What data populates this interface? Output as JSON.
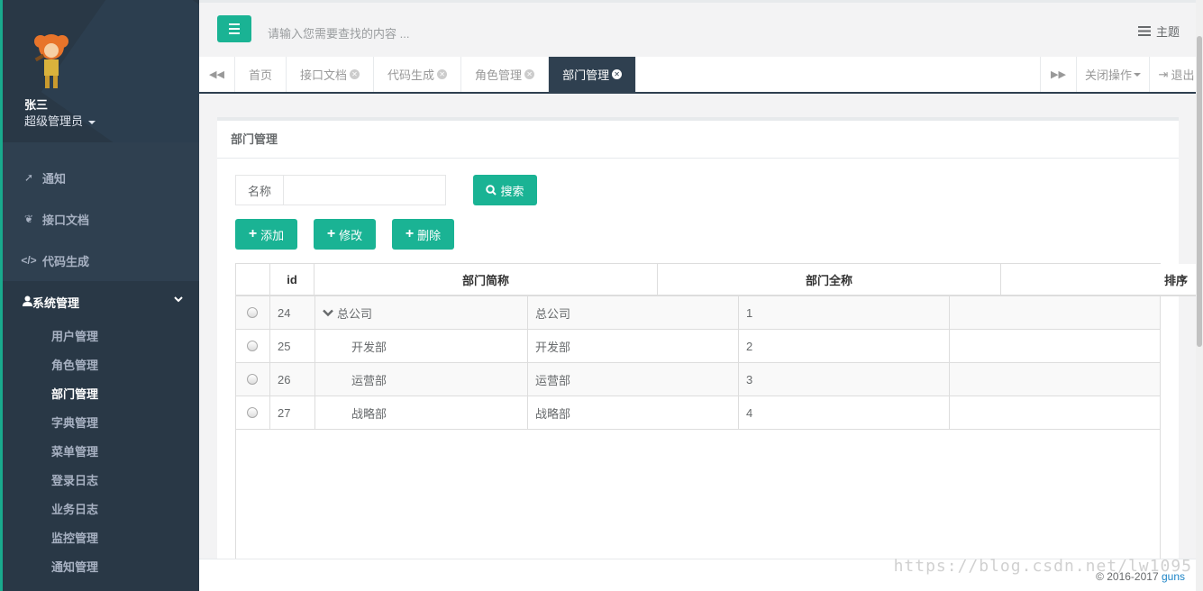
{
  "user": {
    "name": "张三",
    "role": "超级管理员"
  },
  "sidebar": {
    "items": [
      {
        "label": "通知",
        "icon": "rocket-icon"
      },
      {
        "label": "接口文档",
        "icon": "leaf-icon"
      },
      {
        "label": "代码生成",
        "icon": "code-icon"
      }
    ],
    "active_group": {
      "label": "系统管理",
      "icon": "user-icon",
      "children": [
        "用户管理",
        "角色管理",
        "部门管理",
        "字典管理",
        "菜单管理",
        "登录日志",
        "业务日志",
        "监控管理",
        "通知管理"
      ],
      "active_child": "部门管理"
    }
  },
  "topbar": {
    "search_placeholder": "请输入您需要查找的内容 ...",
    "theme_label": "主题"
  },
  "tabs": {
    "items": [
      "首页",
      "接口文档",
      "代码生成",
      "角色管理",
      "部门管理"
    ],
    "active": "部门管理",
    "close_ops": "关闭操作",
    "logout": "退出"
  },
  "panel": {
    "title": "部门管理",
    "search_label": "名称",
    "search_value": "",
    "search_button": "搜索",
    "add_button": "添加",
    "edit_button": "修改",
    "delete_button": "删除"
  },
  "table": {
    "headers": [
      "id",
      "部门简称",
      "部门全称",
      "排序"
    ],
    "rows": [
      {
        "id": "24",
        "short": "总公司",
        "full": "总公司",
        "order": "1",
        "level": 0
      },
      {
        "id": "25",
        "short": "开发部",
        "full": "开发部",
        "order": "2",
        "level": 1
      },
      {
        "id": "26",
        "short": "运营部",
        "full": "运营部",
        "order": "3",
        "level": 1
      },
      {
        "id": "27",
        "short": "战略部",
        "full": "战略部",
        "order": "4",
        "level": 1
      }
    ]
  },
  "footer": {
    "copyright": "© 2016-2017",
    "brand": "guns"
  },
  "watermark": "https://blog.csdn.net/lw1095",
  "colors": {
    "accent": "#1ab394",
    "sidebar": "#2f4050",
    "sidebar_dark": "#293846"
  }
}
